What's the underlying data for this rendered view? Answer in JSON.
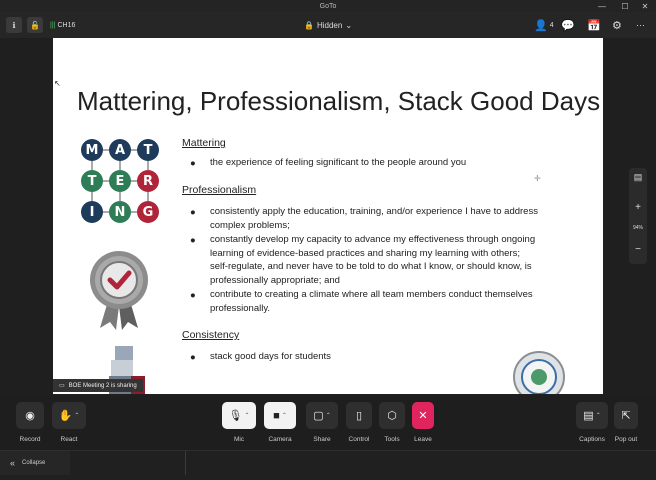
{
  "window": {
    "title": "GoTo",
    "min_glyph": "—",
    "max_glyph": "☐",
    "close_glyph": "✕"
  },
  "toolbar": {
    "info_glyph": "ℹ",
    "lock_glyph": "🔓",
    "room_name": "CH16",
    "hidden_label": "Hidden",
    "hidden_caret": "⌄",
    "participant_count": "4",
    "person_glyph": "👤",
    "chat_glyph": "💬",
    "calendar_glyph": "📅",
    "settings_glyph": "⚙",
    "more_glyph": "···"
  },
  "slide": {
    "title": "Mattering, Professionalism, Stack Good Days",
    "logo_letters": [
      {
        "l": "M",
        "c": "#1f3b5c"
      },
      {
        "l": "A",
        "c": "#1f3b5c"
      },
      {
        "l": "T",
        "c": "#1f3b5c"
      },
      {
        "l": "T",
        "c": "#2e7d57"
      },
      {
        "l": "E",
        "c": "#2e7d57"
      },
      {
        "l": "R",
        "c": "#b0243a"
      },
      {
        "l": "I",
        "c": "#1f3b5c"
      },
      {
        "l": "N",
        "c": "#2e7d57"
      },
      {
        "l": "G",
        "c": "#b0243a"
      }
    ],
    "sections": [
      {
        "heading": "Mattering",
        "bullets": [
          "the experience of feeling significant to the people around you"
        ]
      },
      {
        "heading": "Professionalism",
        "bullets": [
          "consistently apply the education, training, and/or experience I have to address complex problems;",
          "constantly develop my capacity to advance my effectiveness through ongoing learning of evidence-based practices and sharing my learning with others; self-regulate, and never have to be told to do what I know, or should know, is professionally appropriate; and",
          "contribute to creating a climate where all team members conduct themselves professionally."
        ]
      },
      {
        "heading": "Consistency",
        "bullets": [
          "stack good days for students"
        ]
      }
    ],
    "bullet_glyph": "●",
    "sharing_tag": "BOE Meeting 2 is sharing"
  },
  "side_panel": {
    "zoom_in": "+",
    "zoom_level": "94%",
    "zoom_out": "−"
  },
  "controls": {
    "record": "Record",
    "react": "React",
    "mic": "Mic",
    "camera": "Camera",
    "share": "Share",
    "control": "Control",
    "tools": "Tools",
    "leave": "Leave",
    "leave_glyph": "✕",
    "captions": "Captions",
    "popout": "Pop out",
    "caret": "⌃"
  },
  "bottom": {
    "collapse_label": "Collapse",
    "collapse_glyph": "«"
  },
  "colors": {
    "leave": "#e0245e",
    "accent_green": "#4fc36b"
  }
}
